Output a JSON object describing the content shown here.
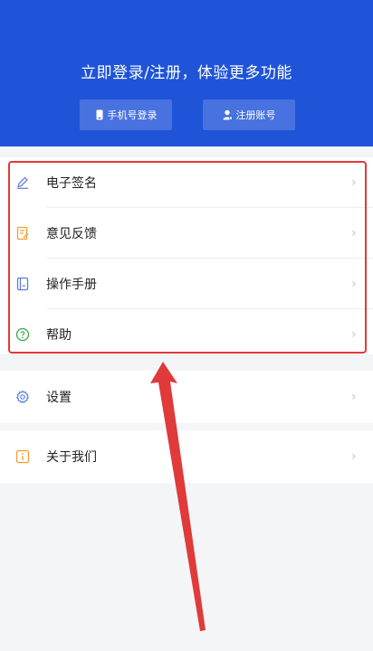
{
  "header": {
    "title": "立即登录/注册，体验更多功能",
    "buttons": [
      {
        "label": "手机号登录",
        "icon": "phone-icon"
      },
      {
        "label": "注册账号",
        "icon": "user-icon"
      }
    ]
  },
  "menu_main": [
    {
      "label": "电子签名",
      "icon": "pen-icon",
      "color": "#6b7fd6"
    },
    {
      "label": "意见反馈",
      "icon": "feedback-icon",
      "color": "#f0a030"
    },
    {
      "label": "操作手册",
      "icon": "manual-icon",
      "color": "#5a7ee0"
    },
    {
      "label": "帮助",
      "icon": "help-icon",
      "color": "#3aa847"
    }
  ],
  "menu_settings": {
    "label": "设置",
    "icon": "gear-icon",
    "color": "#5a7ee0"
  },
  "menu_about": {
    "label": "关于我们",
    "icon": "info-icon",
    "color": "#f0a030"
  },
  "chevron": "›",
  "colors": {
    "header": "#1f54d8",
    "annotation": "#e03a3a"
  }
}
